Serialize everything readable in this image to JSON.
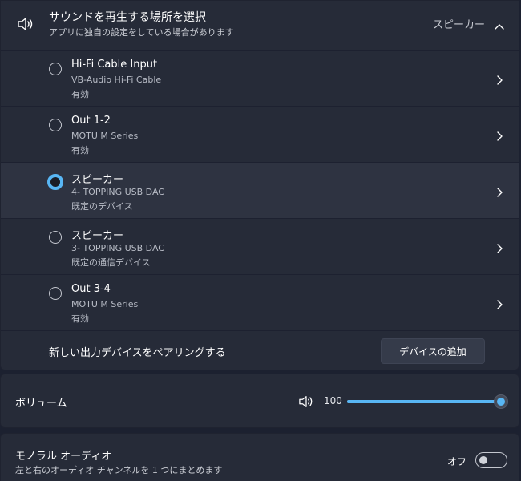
{
  "output": {
    "title": "サウンドを再生する場所を選択",
    "subtitle": "アプリに独自の設定をしている場合があります",
    "current": "スピーカー",
    "devices": [
      {
        "name": "Hi-Fi Cable Input",
        "desc": "VB-Audio Hi-Fi Cable",
        "status": "有効",
        "selected": false
      },
      {
        "name": "Out 1-2",
        "desc": "MOTU M Series",
        "status": "有効",
        "selected": false
      },
      {
        "name": "スピーカー",
        "desc": "4- TOPPING USB DAC",
        "status": "既定のデバイス",
        "selected": true
      },
      {
        "name": "スピーカー",
        "desc": "3- TOPPING USB DAC",
        "status": "既定の通信デバイス",
        "selected": false
      },
      {
        "name": "Out 3-4",
        "desc": "MOTU M Series",
        "status": "有効",
        "selected": false
      }
    ],
    "pair_label": "新しい出力デバイスをペアリングする",
    "add_button": "デバイスの追加"
  },
  "volume": {
    "label": "ボリューム",
    "value": "100",
    "level_percent": 100
  },
  "mono": {
    "title": "モノラル オーディオ",
    "subtitle": "左と右のオーディオ チャンネルを 1 つにまとめます",
    "state": "オフ",
    "enabled": false
  },
  "icons": {
    "speaker": "speaker-icon",
    "collapse": "chevron-up-icon",
    "open": "chevron-right-icon"
  },
  "colors": {
    "accent": "#58b6f4",
    "background": "#1c2130",
    "card": "#262b38",
    "selected_row": "#2e3341"
  }
}
